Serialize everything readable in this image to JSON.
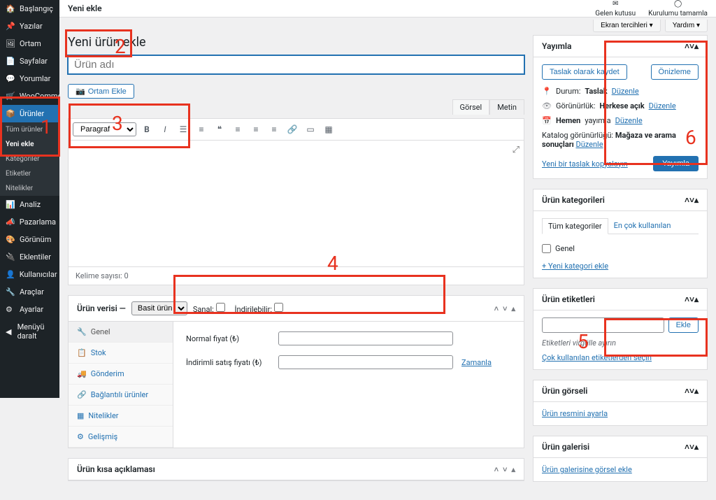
{
  "topbar": {
    "breadcrumb": "Yeni ekle",
    "inbox": "Gelen kutusu",
    "setup": "Kurulumu tamamla"
  },
  "screen": {
    "options": "Ekran tercihleri",
    "help": "Yardım"
  },
  "sidebar": {
    "items": [
      {
        "label": "Başlangıç",
        "icon": "home-icon"
      },
      {
        "label": "Yazılar",
        "icon": "pin-icon"
      },
      {
        "label": "Ortam",
        "icon": "media-icon"
      },
      {
        "label": "Sayfalar",
        "icon": "page-icon"
      },
      {
        "label": "Yorumlar",
        "icon": "comment-icon"
      },
      {
        "label": "WooCommerce",
        "icon": "wc-icon"
      },
      {
        "label": "Ürünler",
        "icon": "product-icon",
        "current": true
      },
      {
        "label": "Analiz",
        "icon": "chart-icon"
      },
      {
        "label": "Pazarlama",
        "icon": "megaphone-icon"
      },
      {
        "label": "Görünüm",
        "icon": "appearance-icon"
      },
      {
        "label": "Eklentiler",
        "icon": "plugin-icon"
      },
      {
        "label": "Kullanıcılar",
        "icon": "users-icon"
      },
      {
        "label": "Araçlar",
        "icon": "tools-icon"
      },
      {
        "label": "Ayarlar",
        "icon": "settings-icon"
      },
      {
        "label": "Menüyü daralt",
        "icon": "collapse-icon"
      }
    ],
    "sub": [
      "Tüm ürünler",
      "Yeni ekle",
      "Kategoriler",
      "Etiketler",
      "Nitelikler"
    ]
  },
  "page": {
    "title": "Yeni ürün ekle",
    "title_placeholder": "Ürün adı"
  },
  "editor": {
    "add_media": "Ortam Ekle",
    "tab_visual": "Görsel",
    "tab_text": "Metin",
    "paragraf": "Paragraf",
    "word_count": "Kelime sayısı: 0"
  },
  "product_data": {
    "heading": "Ürün verisi —",
    "type_options": [
      "Basit ürün"
    ],
    "virtual_label": "Sanal:",
    "downloadable_label": "İndirilebilir:",
    "tabs": [
      "Genel",
      "Stok",
      "Gönderim",
      "Bağlantılı ürünler",
      "Nitelikler",
      "Gelişmiş"
    ],
    "regular_price": "Normal fiyat (₺)",
    "sale_price": "İndirimli satış fiyatı (₺)",
    "schedule": "Zamanla"
  },
  "short_desc": {
    "heading": "Ürün kısa açıklaması"
  },
  "publish": {
    "heading": "Yayımla",
    "save_draft": "Taslak olarak kaydet",
    "preview": "Önizleme",
    "status_label": "Durum:",
    "status_value": "Taslak",
    "edit": "Düzenle",
    "visibility_label": "Görünürlük:",
    "visibility_value": "Herkese açık",
    "publish_now": "Hemen",
    "publish_label2": "yayımla",
    "catalog_label": "Katalog görünürlüğü:",
    "catalog_value": "Mağaza ve arama sonuçları",
    "copy_draft": "Yeni bir taslak kopyalayın",
    "publish_btn": "Yayımla"
  },
  "categories": {
    "heading": "Ürün kategorileri",
    "tab_all": "Tüm kategoriler",
    "tab_used": "En çok kullanılan",
    "items": [
      "Genel"
    ],
    "add_link": "+ Yeni kategori ekle"
  },
  "tags": {
    "heading": "Ürün etiketleri",
    "add_btn": "Ekle",
    "hint": "Etiketleri virgülle ayırın",
    "choose": "Çok kullanılan etiketlerden seçin"
  },
  "image": {
    "heading": "Ürün görseli",
    "set_link": "Ürün resmini ayarla"
  },
  "gallery": {
    "heading": "Ürün galerisi",
    "add_link": "Ürün galerisine görsel ekle"
  },
  "annotations": {
    "n1": "1",
    "n2": "2",
    "n3": "3",
    "n4": "4",
    "n5": "5",
    "n6": "6"
  }
}
